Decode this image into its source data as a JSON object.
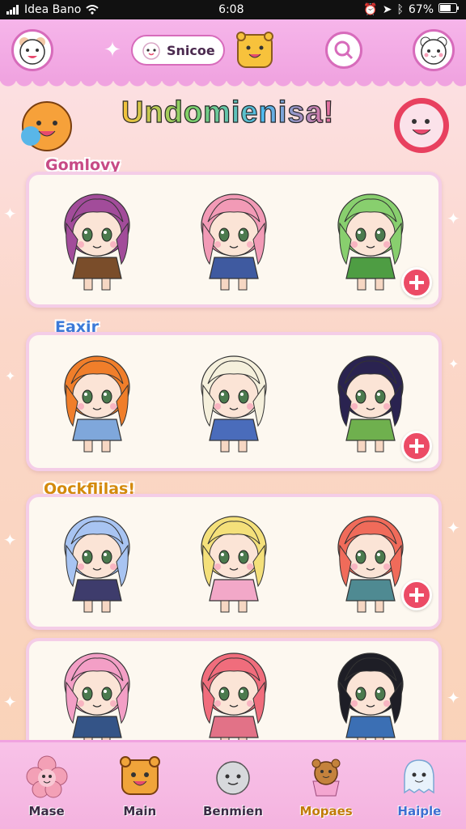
{
  "status": {
    "carrier": "Idea Bano",
    "time": "6:08",
    "battery": "67%"
  },
  "topbar": {
    "brand_label": "Snicoe"
  },
  "header": {
    "title": "Undomienisa!"
  },
  "sections": [
    {
      "label": "Gomlovy",
      "color": "#c74b86"
    },
    {
      "label": "Eaxir",
      "color": "#3d7ad8"
    },
    {
      "label": "Oockflilas!",
      "color": "#d48a0c"
    }
  ],
  "characters": [
    [
      {
        "hair": "#a24c9a",
        "outfit": "#7a4d2a"
      },
      {
        "hair": "#f29ab6",
        "outfit": "#3f5aa0"
      },
      {
        "hair": "#88cf6e",
        "outfit": "#4e9d43"
      }
    ],
    [
      {
        "hair": "#f07e2a",
        "outfit": "#7fa7db"
      },
      {
        "hair": "#f5f0dc",
        "outfit": "#4a6cbb"
      },
      {
        "hair": "#2a2350",
        "outfit": "#6fb04e"
      }
    ],
    [
      {
        "hair": "#a8c4f2",
        "outfit": "#3e3c6c"
      },
      {
        "hair": "#f4e07a",
        "outfit": "#f2a8c8"
      },
      {
        "hair": "#f06b5a",
        "outfit": "#4f8a92"
      }
    ],
    [
      {
        "hair": "#f39fc6",
        "outfit": "#345487"
      },
      {
        "hair": "#f06d7c",
        "outfit": "#e27287"
      },
      {
        "hair": "#1e1e26",
        "outfit": "#3b6fb4"
      }
    ]
  ],
  "bottom_nav": [
    {
      "label": "Mase",
      "icon": "flower-icon"
    },
    {
      "label": "Main",
      "icon": "bear-icon"
    },
    {
      "label": "Benmien",
      "icon": "ghost-icon"
    },
    {
      "label": "Mopaes",
      "icon": "cupcake-bear-icon"
    },
    {
      "label": "Haiple",
      "icon": "ghost-blue-icon"
    }
  ]
}
